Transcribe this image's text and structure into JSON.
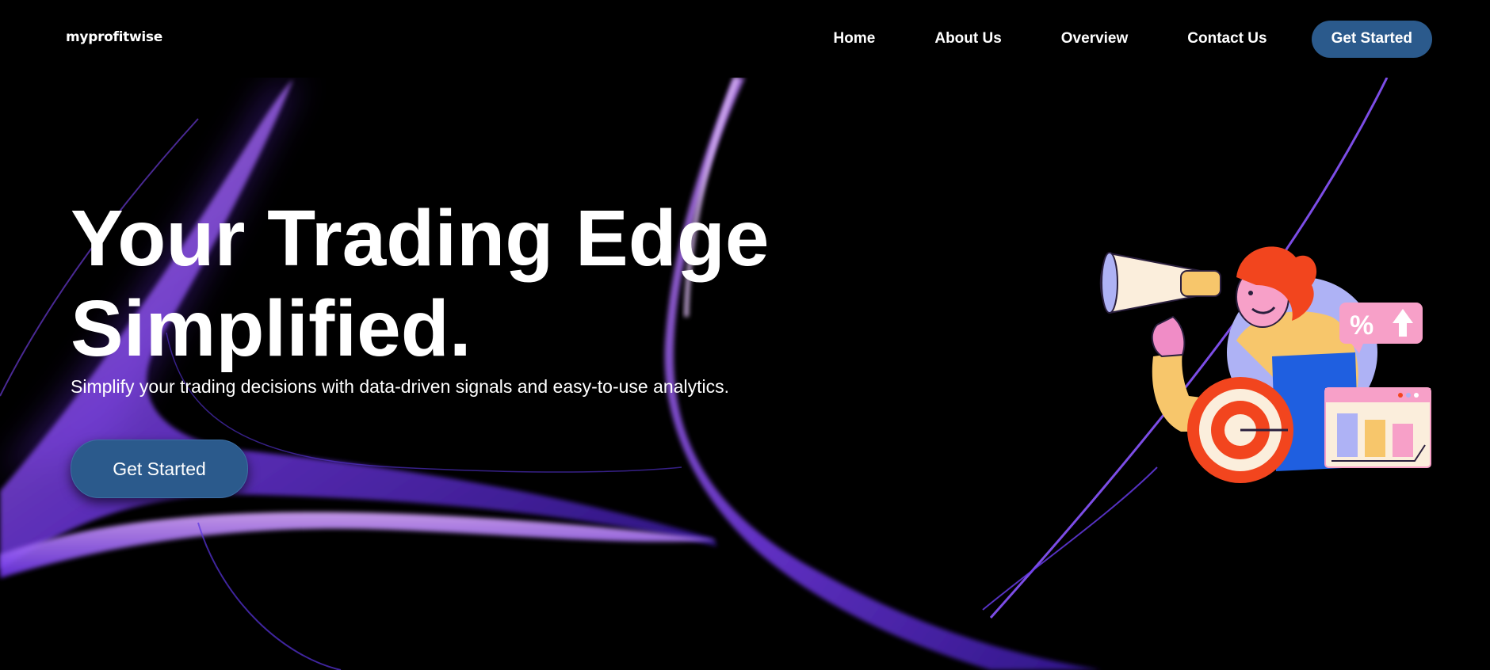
{
  "header": {
    "logo": "myprofitwise",
    "nav": [
      "Home",
      "About Us",
      "Overview",
      "Contact Us"
    ],
    "cta": "Get Started"
  },
  "hero": {
    "title_line1": "Your Trading Edge",
    "title_line2": "Simplified.",
    "subtitle": "Simplify your trading decisions with data-driven signals and easy-to-use analytics.",
    "cta": "Get Started"
  },
  "illustration": {
    "badge_text": "%"
  },
  "colors": {
    "background": "#000000",
    "accent": "#2b5a8c",
    "swirl": "#8a4dff"
  }
}
